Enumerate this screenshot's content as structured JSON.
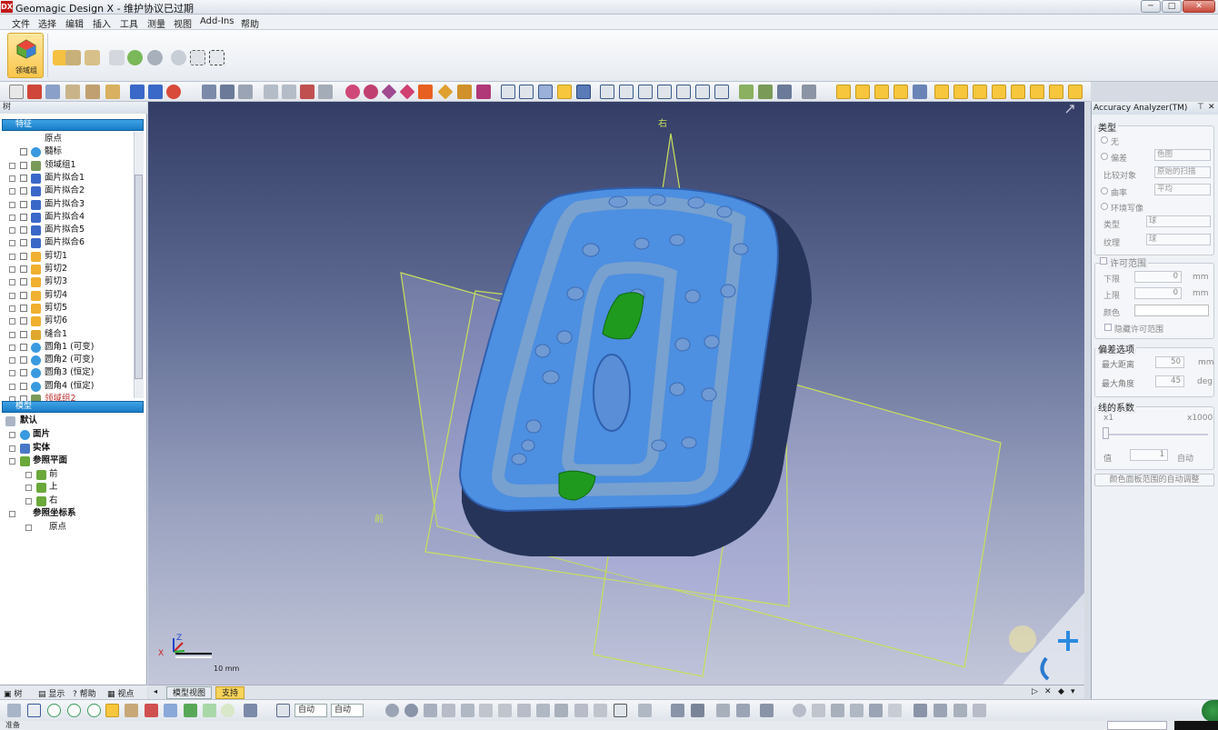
{
  "titlebar": {
    "app_logo": "DX",
    "title": "Geomagic Design X - 维护协议已过期",
    "minimize": "─",
    "maximize": "□",
    "close": "✕"
  },
  "menu": [
    "文件",
    "选择",
    "编辑",
    "插入",
    "工具",
    "测量",
    "视图",
    "Add-Ins",
    "帮助"
  ],
  "ribbon": {
    "region_group_label": "领域组"
  },
  "tree": {
    "panel_title": "树",
    "features_header": "特征",
    "features": [
      {
        "label": "原点",
        "icon": "origin-icon"
      },
      {
        "label": "髓标",
        "icon": "sphere-icon"
      },
      {
        "label": "领域组1",
        "icon": "region-group-icon"
      },
      {
        "label": "面片拟合1",
        "icon": "mesh-fit-icon"
      },
      {
        "label": "面片拟合2",
        "icon": "mesh-fit-icon"
      },
      {
        "label": "面片拟合3",
        "icon": "mesh-fit-icon"
      },
      {
        "label": "面片拟合4",
        "icon": "mesh-fit-icon"
      },
      {
        "label": "面片拟合5",
        "icon": "mesh-fit-icon"
      },
      {
        "label": "面片拟合6",
        "icon": "mesh-fit-icon"
      },
      {
        "label": "剪切1",
        "icon": "cut-icon"
      },
      {
        "label": "剪切2",
        "icon": "cut-icon"
      },
      {
        "label": "剪切3",
        "icon": "cut-icon"
      },
      {
        "label": "剪切4",
        "icon": "cut-icon"
      },
      {
        "label": "剪切5",
        "icon": "cut-icon"
      },
      {
        "label": "剪切6",
        "icon": "cut-icon"
      },
      {
        "label": "缝合1",
        "icon": "sew-icon"
      },
      {
        "label": "圆角1 (可变)",
        "icon": "fillet-icon"
      },
      {
        "label": "圆角2 (可变)",
        "icon": "fillet-icon"
      },
      {
        "label": "圆角3 (恒定)",
        "icon": "fillet-icon"
      },
      {
        "label": "圆角4 (恒定)",
        "icon": "fillet-icon"
      },
      {
        "label": "领域组2",
        "icon": "region-group-icon"
      }
    ],
    "model_header": "模型",
    "model_default": "默认",
    "model_items": [
      {
        "label": "面片",
        "icon": "mesh-icon",
        "bold": true
      },
      {
        "label": "实体",
        "icon": "solid-icon",
        "bold": true
      },
      {
        "label": "参照平面",
        "icon": "plane-icon",
        "bold": true
      },
      {
        "label": "前",
        "icon": "plane-icon",
        "bold": false
      },
      {
        "label": "上",
        "icon": "plane-icon",
        "bold": false
      },
      {
        "label": "右",
        "icon": "plane-icon",
        "bold": false
      },
      {
        "label": "参照坐标系",
        "icon": "coordinate-system-icon",
        "bold": true
      },
      {
        "label": "原点",
        "icon": "origin-icon",
        "bold": false
      }
    ],
    "tabs": [
      "树",
      "显示",
      "帮助",
      "视点"
    ]
  },
  "viewport": {
    "plane_label_right": "右",
    "plane_label_front": "前",
    "scale_label": "10 mm",
    "axis_x": "X",
    "axis_z": "Z"
  },
  "doc_tabs": [
    "模型视图",
    "支持"
  ],
  "bottom_toolbar": {
    "combo1": "自动",
    "combo2": "自动"
  },
  "status": {
    "text": "准备"
  },
  "accuracy": {
    "title": "Accuracy Analyzer(TM)",
    "type_group": "类型",
    "type_none": "无",
    "deviation": "偏差",
    "deviation_value": "色图",
    "compare_with": "比较对象",
    "compare_value": "原始的扫描",
    "curvature": "曲率",
    "curvature_value": "平均",
    "env_map": "环境写像",
    "kind": "类型",
    "kind_value": "球",
    "texture": "纹理",
    "texture_value": "球",
    "tolerance_group": "许可范围",
    "lower": "下限",
    "lower_value": "0",
    "upper": "上限",
    "upper_value": "0",
    "unit_mm": "mm",
    "color": "颜色",
    "hide_tolerance": "隐藏许可范围",
    "dev_options_group": "偏差选项",
    "max_distance": "最大距离",
    "max_distance_value": "50",
    "max_angle": "最大角度",
    "max_angle_value": "45",
    "unit_deg": "deg",
    "line_factor_group": "线的系数",
    "factor_min": "x1",
    "factor_max": "x1000",
    "value": "值",
    "value_value": "1",
    "auto": "自动",
    "auto_adjust_btn": "颜色面板范围的自动调整"
  },
  "colors": {
    "mesh_blue": "#4d8fe0",
    "selection_green": "#1f9a1f",
    "plane_outline": "#c8e05a",
    "tree_header": "#1f87d0",
    "highlight": "#f7c63c"
  }
}
